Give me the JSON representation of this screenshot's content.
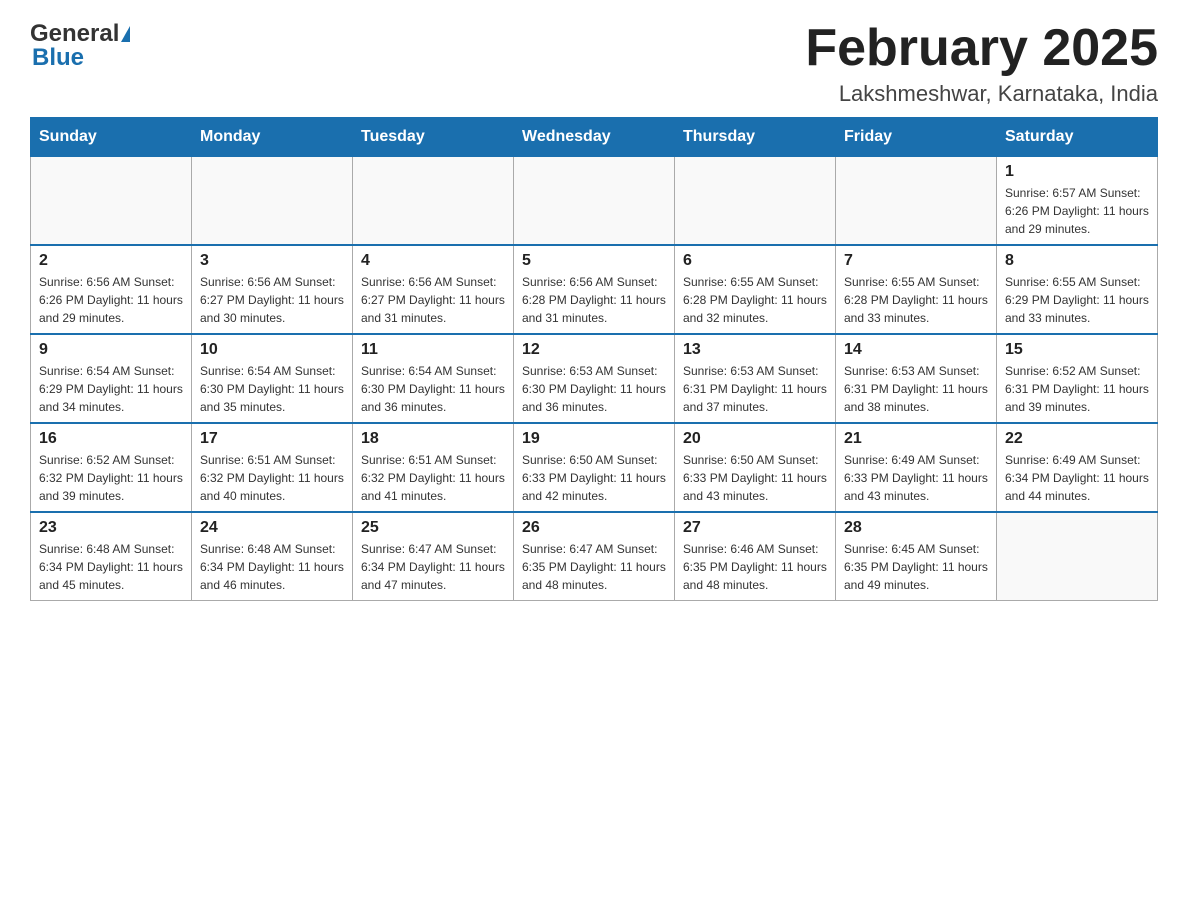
{
  "logo": {
    "general": "General",
    "blue": "Blue"
  },
  "title": {
    "month": "February 2025",
    "location": "Lakshmeshwar, Karnataka, India"
  },
  "weekdays": [
    "Sunday",
    "Monday",
    "Tuesday",
    "Wednesday",
    "Thursday",
    "Friday",
    "Saturday"
  ],
  "weeks": [
    [
      {
        "day": "",
        "info": ""
      },
      {
        "day": "",
        "info": ""
      },
      {
        "day": "",
        "info": ""
      },
      {
        "day": "",
        "info": ""
      },
      {
        "day": "",
        "info": ""
      },
      {
        "day": "",
        "info": ""
      },
      {
        "day": "1",
        "info": "Sunrise: 6:57 AM\nSunset: 6:26 PM\nDaylight: 11 hours and 29 minutes."
      }
    ],
    [
      {
        "day": "2",
        "info": "Sunrise: 6:56 AM\nSunset: 6:26 PM\nDaylight: 11 hours and 29 minutes."
      },
      {
        "day": "3",
        "info": "Sunrise: 6:56 AM\nSunset: 6:27 PM\nDaylight: 11 hours and 30 minutes."
      },
      {
        "day": "4",
        "info": "Sunrise: 6:56 AM\nSunset: 6:27 PM\nDaylight: 11 hours and 31 minutes."
      },
      {
        "day": "5",
        "info": "Sunrise: 6:56 AM\nSunset: 6:28 PM\nDaylight: 11 hours and 31 minutes."
      },
      {
        "day": "6",
        "info": "Sunrise: 6:55 AM\nSunset: 6:28 PM\nDaylight: 11 hours and 32 minutes."
      },
      {
        "day": "7",
        "info": "Sunrise: 6:55 AM\nSunset: 6:28 PM\nDaylight: 11 hours and 33 minutes."
      },
      {
        "day": "8",
        "info": "Sunrise: 6:55 AM\nSunset: 6:29 PM\nDaylight: 11 hours and 33 minutes."
      }
    ],
    [
      {
        "day": "9",
        "info": "Sunrise: 6:54 AM\nSunset: 6:29 PM\nDaylight: 11 hours and 34 minutes."
      },
      {
        "day": "10",
        "info": "Sunrise: 6:54 AM\nSunset: 6:30 PM\nDaylight: 11 hours and 35 minutes."
      },
      {
        "day": "11",
        "info": "Sunrise: 6:54 AM\nSunset: 6:30 PM\nDaylight: 11 hours and 36 minutes."
      },
      {
        "day": "12",
        "info": "Sunrise: 6:53 AM\nSunset: 6:30 PM\nDaylight: 11 hours and 36 minutes."
      },
      {
        "day": "13",
        "info": "Sunrise: 6:53 AM\nSunset: 6:31 PM\nDaylight: 11 hours and 37 minutes."
      },
      {
        "day": "14",
        "info": "Sunrise: 6:53 AM\nSunset: 6:31 PM\nDaylight: 11 hours and 38 minutes."
      },
      {
        "day": "15",
        "info": "Sunrise: 6:52 AM\nSunset: 6:31 PM\nDaylight: 11 hours and 39 minutes."
      }
    ],
    [
      {
        "day": "16",
        "info": "Sunrise: 6:52 AM\nSunset: 6:32 PM\nDaylight: 11 hours and 39 minutes."
      },
      {
        "day": "17",
        "info": "Sunrise: 6:51 AM\nSunset: 6:32 PM\nDaylight: 11 hours and 40 minutes."
      },
      {
        "day": "18",
        "info": "Sunrise: 6:51 AM\nSunset: 6:32 PM\nDaylight: 11 hours and 41 minutes."
      },
      {
        "day": "19",
        "info": "Sunrise: 6:50 AM\nSunset: 6:33 PM\nDaylight: 11 hours and 42 minutes."
      },
      {
        "day": "20",
        "info": "Sunrise: 6:50 AM\nSunset: 6:33 PM\nDaylight: 11 hours and 43 minutes."
      },
      {
        "day": "21",
        "info": "Sunrise: 6:49 AM\nSunset: 6:33 PM\nDaylight: 11 hours and 43 minutes."
      },
      {
        "day": "22",
        "info": "Sunrise: 6:49 AM\nSunset: 6:34 PM\nDaylight: 11 hours and 44 minutes."
      }
    ],
    [
      {
        "day": "23",
        "info": "Sunrise: 6:48 AM\nSunset: 6:34 PM\nDaylight: 11 hours and 45 minutes."
      },
      {
        "day": "24",
        "info": "Sunrise: 6:48 AM\nSunset: 6:34 PM\nDaylight: 11 hours and 46 minutes."
      },
      {
        "day": "25",
        "info": "Sunrise: 6:47 AM\nSunset: 6:34 PM\nDaylight: 11 hours and 47 minutes."
      },
      {
        "day": "26",
        "info": "Sunrise: 6:47 AM\nSunset: 6:35 PM\nDaylight: 11 hours and 48 minutes."
      },
      {
        "day": "27",
        "info": "Sunrise: 6:46 AM\nSunset: 6:35 PM\nDaylight: 11 hours and 48 minutes."
      },
      {
        "day": "28",
        "info": "Sunrise: 6:45 AM\nSunset: 6:35 PM\nDaylight: 11 hours and 49 minutes."
      },
      {
        "day": "",
        "info": ""
      }
    ]
  ]
}
